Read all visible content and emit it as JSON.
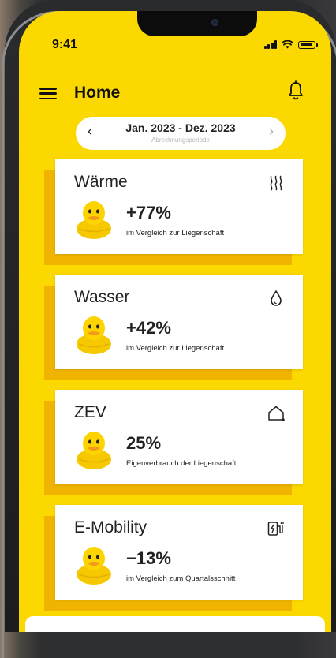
{
  "status_bar": {
    "time": "9:41"
  },
  "header": {
    "title": "Home"
  },
  "period": {
    "range": "Jan. 2023 - Dez. 2023",
    "label": "Abrechnungsperiode",
    "prev": "‹",
    "next": "›"
  },
  "cards": [
    {
      "title": "Wärme",
      "value": "+77%",
      "caption": "im Vergleich zur Liegenschaft",
      "icon": "heat-icon"
    },
    {
      "title": "Wasser",
      "value": "+42%",
      "caption": "im Vergleich zur Liegenschaft",
      "icon": "water-drop-icon"
    },
    {
      "title": "ZEV",
      "value": "25%",
      "caption": "Eigenverbrauch der Liegenschaft",
      "icon": "house-icon"
    },
    {
      "title": "E-Mobility",
      "value": "−13%",
      "caption": "im Vergleich zum Quartalsschnitt",
      "icon": "ev-charger-icon"
    }
  ],
  "colors": {
    "background": "#fbd800",
    "card_shadow": "#f0b400",
    "card": "#ffffff",
    "text": "#222222"
  }
}
